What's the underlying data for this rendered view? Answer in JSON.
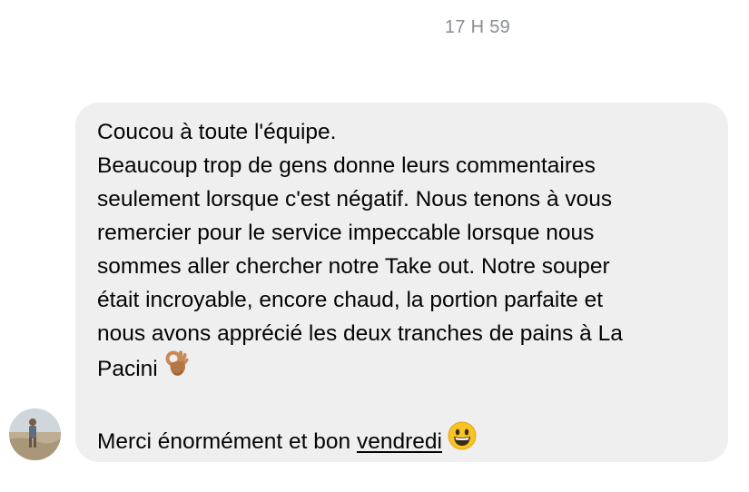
{
  "message": {
    "timestamp": "17 H 59",
    "lines": [
      "Coucou à toute l'équipe.",
      "Beaucoup trop de gens donne leurs commentaires",
      "seulement lorsque c'est négatif. Nous tenons à vous",
      "remercier pour le service impeccable lorsque nous",
      "sommes aller chercher notre Take out. Notre souper",
      "était incroyable, encore chaud, la portion parfaite et",
      "nous avons apprécié les deux tranches de pains à La",
      "Pacini"
    ],
    "closing_prefix": "Merci énormément et bon ",
    "closing_link": "vendredi",
    "emoji_ok": "ok-hand-emoji",
    "emoji_smile": "grinning-face-emoji"
  },
  "colors": {
    "bubble": "#efefef",
    "timestamp": "#8a8d91",
    "text": "#050505"
  }
}
